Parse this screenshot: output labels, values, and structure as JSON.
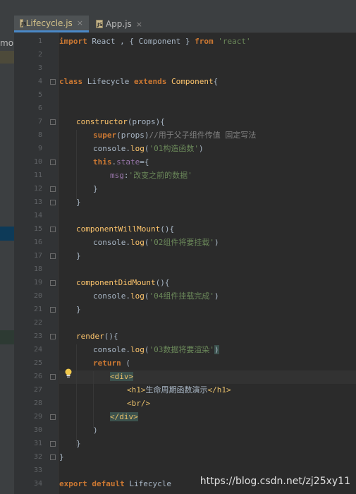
{
  "tabs": [
    {
      "label": "Lifecycle.js",
      "active": true,
      "icon": "js-file-icon",
      "close": "×"
    },
    {
      "label": "App.js",
      "active": false,
      "icon": "js-file-icon",
      "close": "×"
    }
  ],
  "left_panel": {
    "label": "mo"
  },
  "line_numbers": [
    "1",
    "2",
    "3",
    "4",
    "5",
    "6",
    "7",
    "8",
    "9",
    "10",
    "11",
    "12",
    "13",
    "14",
    "15",
    "16",
    "17",
    "18",
    "19",
    "20",
    "21",
    "22",
    "23",
    "24",
    "25",
    "26",
    "27",
    "28",
    "29",
    "30",
    "31",
    "32",
    "33",
    "34"
  ],
  "code": {
    "l1": {
      "a": "import",
      "b": " React , { Component } ",
      "c": "from",
      "d": " ",
      "e": "'react'"
    },
    "l4": {
      "a": "class",
      "b": " Lifecycle ",
      "c": "extends",
      "d": " ",
      "e": "Component",
      "f": "{"
    },
    "l7": {
      "a": "constructor",
      "b": "(props){"
    },
    "l8": {
      "a": "super",
      "b": "(props)",
      "c": "//用于父子组件传值 固定写法"
    },
    "l9": {
      "a": "console.",
      "b": "log",
      "c": "(",
      "d": "'01构造函数'",
      "e": ")"
    },
    "l10": {
      "a": "this",
      "b": ".",
      "c": "state",
      "d": "={"
    },
    "l11": {
      "a": "msg",
      "b": ":",
      "c": "'改变之前的数据'"
    },
    "l12": {
      "a": "}"
    },
    "l13": {
      "a": "}"
    },
    "l15": {
      "a": "componentWillMount",
      "b": "(){"
    },
    "l16": {
      "a": "console.",
      "b": "log",
      "c": "(",
      "d": "'02组件将要挂载'",
      "e": ")"
    },
    "l17": {
      "a": "}"
    },
    "l19": {
      "a": "componentDidMount",
      "b": "(){"
    },
    "l20": {
      "a": "console.",
      "b": "log",
      "c": "(",
      "d": "'04组件挂载完成'",
      "e": ")"
    },
    "l21": {
      "a": "}"
    },
    "l23": {
      "a": "render",
      "b": "(){"
    },
    "l24": {
      "a": "console.",
      "b": "log",
      "c": "(",
      "d": "'03数据将要渲染'",
      "e": ")"
    },
    "l25": {
      "a": "return",
      "b": " ("
    },
    "l26": {
      "a": "<div>"
    },
    "l27": {
      "a": "<h1>",
      "b": "生命周期函数演示",
      "c": "</h1>"
    },
    "l28": {
      "a": "<br/>"
    },
    "l29": {
      "a": "</div>"
    },
    "l30": {
      "a": ")"
    },
    "l31": {
      "a": "}"
    },
    "l32": {
      "a": "}"
    },
    "l34": {
      "a": "export",
      "b": " ",
      "c": "default",
      "d": " Lifecycle"
    }
  },
  "watermark": "https://blog.csdn.net/zj25xy11",
  "colors": {
    "background": "#2b2b2b",
    "keyword": "#cc7832",
    "string": "#6a8759",
    "function": "#ffc66d",
    "property": "#9876aa",
    "tag": "#e8bf6a"
  }
}
